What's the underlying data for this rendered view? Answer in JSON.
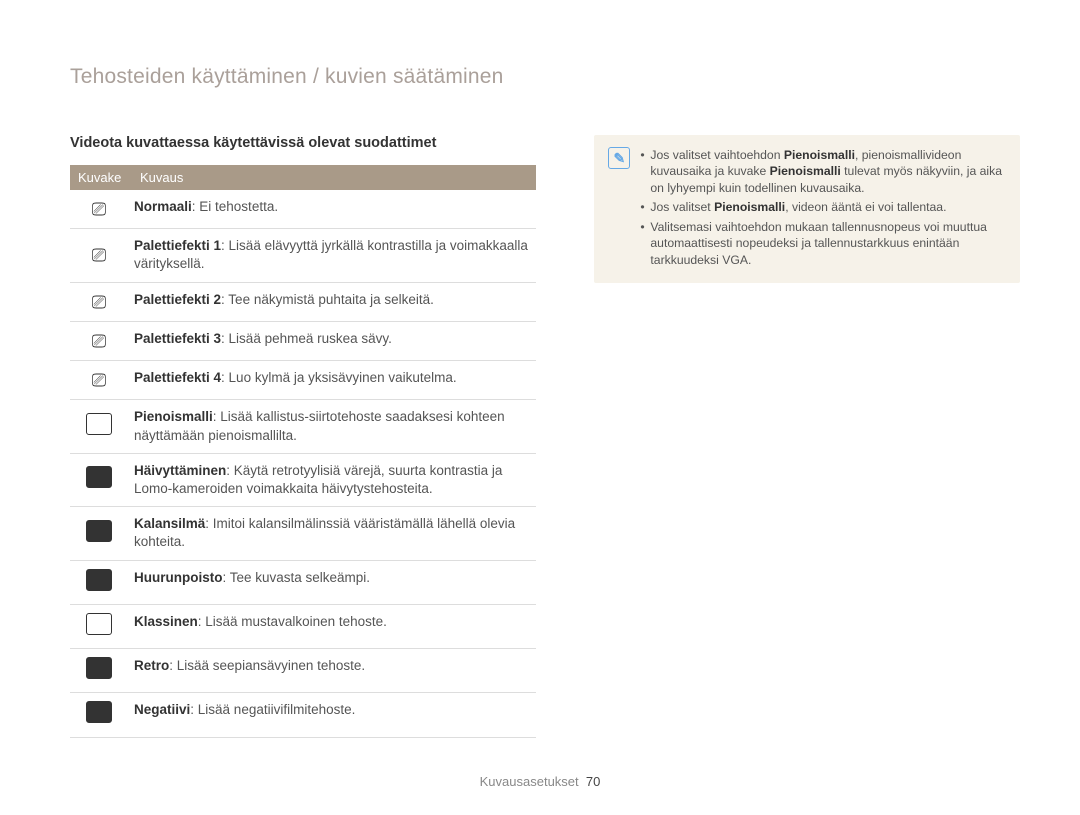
{
  "page_title": "Tehosteiden käyttäminen / kuvien säätäminen",
  "section_title": "Videota kuvattaessa käytettävissä olevat suodattimet",
  "table": {
    "headers": {
      "icon": "Kuvake",
      "desc": "Kuvaus"
    },
    "rows": [
      {
        "icon": "plain",
        "bold": "Normaali",
        "rest": ": Ei tehostetta."
      },
      {
        "icon": "plain",
        "bold": "Palettiefekti 1",
        "rest": ": Lisää elävyyttä jyrkällä kontrastilla ja voimakkaalla värityksellä."
      },
      {
        "icon": "plain",
        "bold": "Palettiefekti 2",
        "rest": ": Tee näkymistä puhtaita ja selkeitä."
      },
      {
        "icon": "plain",
        "bold": "Palettiefekti 3",
        "rest": ": Lisää pehmeä ruskea sävy."
      },
      {
        "icon": "plain",
        "bold": "Palettiefekti 4",
        "rest": ": Luo kylmä ja yksisävyinen vaikutelma."
      },
      {
        "icon": "box",
        "bold": "Pienoismalli",
        "rest": ": Lisää kallistus-siirtotehoste saadaksesi kohteen näyttämään pienoismallilta."
      },
      {
        "icon": "box-dark",
        "bold": "Häivyttäminen",
        "rest": ": Käytä retrotyylisiä värejä, suurta kontrastia ja Lomo-kameroiden voimakkaita häivytystehosteita."
      },
      {
        "icon": "box-dark",
        "bold": "Kalansilmä",
        "rest": ": Imitoi kalansilmälinssiä vääristämällä lähellä olevia kohteita."
      },
      {
        "icon": "box-dark",
        "bold": "Huurunpoisto",
        "rest": ": Tee kuvasta selkeämpi."
      },
      {
        "icon": "box",
        "bold": "Klassinen",
        "rest": ": Lisää mustavalkoinen tehoste."
      },
      {
        "icon": "box-dark",
        "bold": "Retro",
        "rest": ": Lisää seepiansävyinen tehoste."
      },
      {
        "icon": "box-dark",
        "bold": "Negatiivi",
        "rest": ": Lisää negatiivifilmitehoste."
      }
    ]
  },
  "notes": [
    {
      "pre": "Jos valitset vaihtoehdon ",
      "b1": "Pienoismalli",
      "mid": ", pienoismallivideon kuvausaika ja kuvake ",
      "b2": "Pienoismalli",
      "post": " tulevat myös näkyviin, ja aika on lyhyempi kuin todellinen kuvausaika."
    },
    {
      "pre": "Jos valitset ",
      "b1": "Pienoismalli",
      "mid": ", videon ääntä ei voi tallentaa.",
      "b2": "",
      "post": ""
    },
    {
      "pre": "Valitsemasi vaihtoehdon mukaan tallennusnopeus voi muuttua automaattisesti nopeudeksi ",
      "b1": "",
      "mid": "",
      "b2": "",
      "post": " ja tallennustarkkuus enintään tarkkuudeksi VGA."
    }
  ],
  "footer": {
    "label": "Kuvausasetukset",
    "page": "70"
  }
}
